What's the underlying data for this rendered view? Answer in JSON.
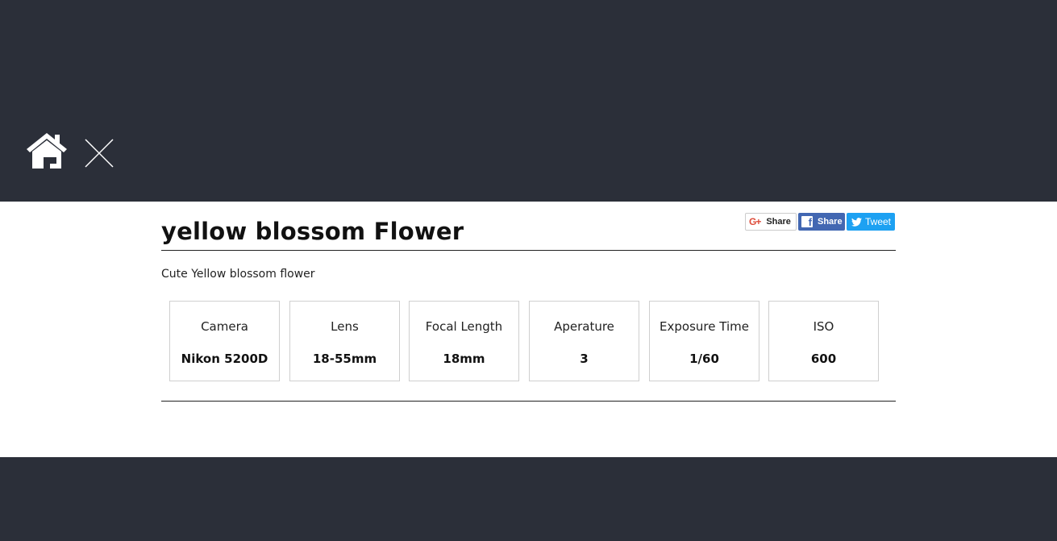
{
  "nav": {
    "home_icon": "home-icon",
    "close_icon": "close-icon"
  },
  "photo": {
    "title": "yellow blossom Flower",
    "description": "Cute Yellow blossom flower"
  },
  "share": {
    "google_label": "Share",
    "google_glyph": "G+",
    "facebook_label": "Share",
    "facebook_glyph": "f",
    "twitter_label": "Tweet"
  },
  "stats": [
    {
      "label": "Camera",
      "value": "Nikon 5200D"
    },
    {
      "label": "Lens",
      "value": "18-55mm"
    },
    {
      "label": "Focal Length",
      "value": "18mm"
    },
    {
      "label": "Aperature",
      "value": "3"
    },
    {
      "label": "Exposure Time",
      "value": "1/60"
    },
    {
      "label": "ISO",
      "value": "600"
    }
  ],
  "colors": {
    "background": "#2b2f39",
    "panel": "#ffffff",
    "facebook": "#4267b2",
    "twitter": "#1da1f2",
    "google": "#dd4b39"
  }
}
